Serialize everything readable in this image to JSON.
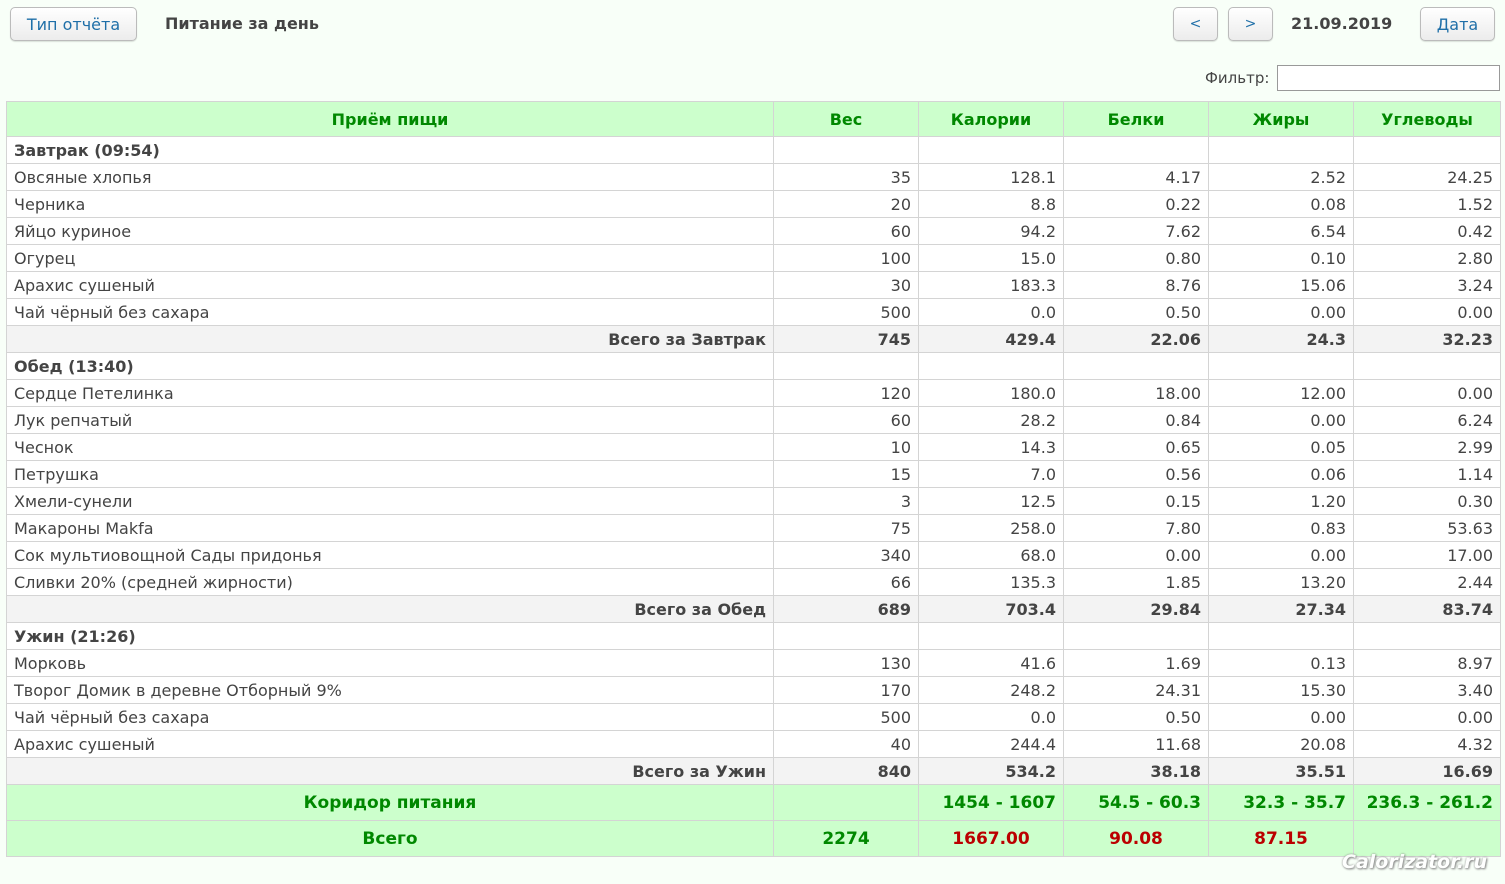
{
  "toolbar": {
    "report_type_label": "Тип отчёта",
    "page_title": "Питание за день",
    "prev_label": "<",
    "next_label": ">",
    "date": "21.09.2019",
    "date_button_label": "Дата"
  },
  "filter": {
    "label": "Фильтр:",
    "value": ""
  },
  "table": {
    "headers": {
      "meal": "Приём пищи",
      "weight": "Вес",
      "calories": "Калории",
      "protein": "Белки",
      "fat": "Жиры",
      "carbs": "Углеводы"
    },
    "groups": [
      {
        "title": "Завтрак (09:54)",
        "items": [
          {
            "name": "Овсяные хлопья",
            "weight": "35",
            "calories": "128.1",
            "protein": "4.17",
            "fat": "2.52",
            "carbs": "24.25"
          },
          {
            "name": "Черника",
            "weight": "20",
            "calories": "8.8",
            "protein": "0.22",
            "fat": "0.08",
            "carbs": "1.52"
          },
          {
            "name": "Яйцо куриное",
            "weight": "60",
            "calories": "94.2",
            "protein": "7.62",
            "fat": "6.54",
            "carbs": "0.42"
          },
          {
            "name": "Огурец",
            "weight": "100",
            "calories": "15.0",
            "protein": "0.80",
            "fat": "0.10",
            "carbs": "2.80"
          },
          {
            "name": "Арахис сушеный",
            "weight": "30",
            "calories": "183.3",
            "protein": "8.76",
            "fat": "15.06",
            "carbs": "3.24"
          },
          {
            "name": "Чай чёрный без сахара",
            "weight": "500",
            "calories": "0.0",
            "protein": "0.50",
            "fat": "0.00",
            "carbs": "0.00"
          }
        ],
        "subtotal": {
          "label": "Всего за Завтрак",
          "weight": "745",
          "calories": "429.4",
          "protein": "22.06",
          "fat": "24.3",
          "carbs": "32.23"
        }
      },
      {
        "title": "Обед (13:40)",
        "items": [
          {
            "name": "Сердце Петелинка",
            "weight": "120",
            "calories": "180.0",
            "protein": "18.00",
            "fat": "12.00",
            "carbs": "0.00"
          },
          {
            "name": "Лук репчатый",
            "weight": "60",
            "calories": "28.2",
            "protein": "0.84",
            "fat": "0.00",
            "carbs": "6.24"
          },
          {
            "name": "Чеснок",
            "weight": "10",
            "calories": "14.3",
            "protein": "0.65",
            "fat": "0.05",
            "carbs": "2.99"
          },
          {
            "name": "Петрушка",
            "weight": "15",
            "calories": "7.0",
            "protein": "0.56",
            "fat": "0.06",
            "carbs": "1.14"
          },
          {
            "name": "Хмели-сунели",
            "weight": "3",
            "calories": "12.5",
            "protein": "0.15",
            "fat": "1.20",
            "carbs": "0.30"
          },
          {
            "name": "Макароны Makfa",
            "weight": "75",
            "calories": "258.0",
            "protein": "7.80",
            "fat": "0.83",
            "carbs": "53.63"
          },
          {
            "name": "Сок мультиовощной Сады придонья",
            "weight": "340",
            "calories": "68.0",
            "protein": "0.00",
            "fat": "0.00",
            "carbs": "17.00"
          },
          {
            "name": "Сливки 20% (средней жирности)",
            "weight": "66",
            "calories": "135.3",
            "protein": "1.85",
            "fat": "13.20",
            "carbs": "2.44"
          }
        ],
        "subtotal": {
          "label": "Всего за Обед",
          "weight": "689",
          "calories": "703.4",
          "protein": "29.84",
          "fat": "27.34",
          "carbs": "83.74"
        }
      },
      {
        "title": "Ужин (21:26)",
        "items": [
          {
            "name": "Морковь",
            "weight": "130",
            "calories": "41.6",
            "protein": "1.69",
            "fat": "0.13",
            "carbs": "8.97"
          },
          {
            "name": "Творог Домик в деревне Отборный 9%",
            "weight": "170",
            "calories": "248.2",
            "protein": "24.31",
            "fat": "15.30",
            "carbs": "3.40"
          },
          {
            "name": "Чай чёрный без сахара",
            "weight": "500",
            "calories": "0.0",
            "protein": "0.50",
            "fat": "0.00",
            "carbs": "0.00"
          },
          {
            "name": "Арахис сушеный",
            "weight": "40",
            "calories": "244.4",
            "protein": "11.68",
            "fat": "20.08",
            "carbs": "4.32"
          }
        ],
        "subtotal": {
          "label": "Всего за Ужин",
          "weight": "840",
          "calories": "534.2",
          "protein": "38.18",
          "fat": "35.51",
          "carbs": "16.69"
        }
      }
    ],
    "corridor": {
      "label": "Коридор питания",
      "weight": "",
      "calories": "1454 - 1607",
      "protein": "54.5 - 60.3",
      "fat": "32.3 - 35.7",
      "carbs": "236.3 - 261.2"
    },
    "total": {
      "label": "Всего",
      "weight": "2274",
      "calories": "1667.00",
      "protein": "90.08",
      "fat": "87.15",
      "carbs": ""
    }
  },
  "watermark": "Calorizator.ru"
}
